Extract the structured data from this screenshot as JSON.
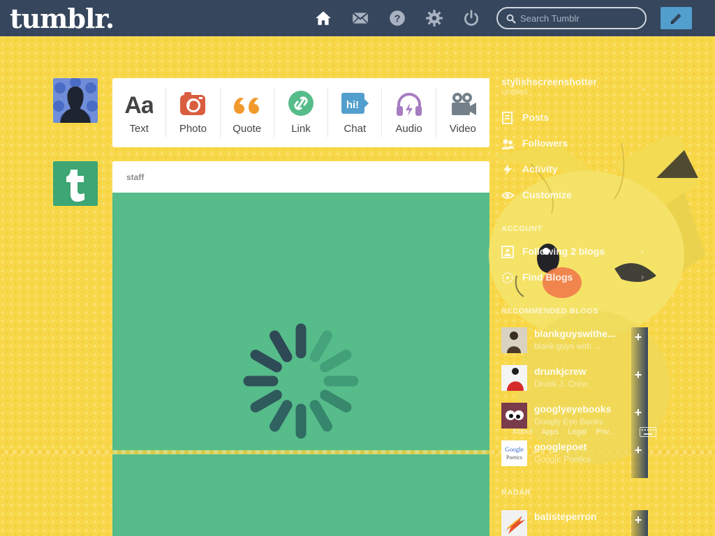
{
  "header": {
    "logo": "tumblr.",
    "search_placeholder": "Search Tumblr",
    "nav_icons": [
      "home-icon",
      "mail-icon",
      "help-icon",
      "gear-icon",
      "power-icon"
    ],
    "compose_icon": "pencil-icon",
    "colors": {
      "background": "#36465d",
      "compose": "#529ecc"
    }
  },
  "post_types": [
    {
      "label": "Text",
      "icon": "text-icon",
      "color": "#444444"
    },
    {
      "label": "Photo",
      "icon": "camera-icon",
      "color": "#d95e40"
    },
    {
      "label": "Quote",
      "icon": "quote-icon",
      "color": "#f2992e"
    },
    {
      "label": "Link",
      "icon": "link-icon",
      "color": "#56bc8a"
    },
    {
      "label": "Chat",
      "icon": "chat-icon",
      "color": "#529ecc"
    },
    {
      "label": "Audio",
      "icon": "headphones-icon",
      "color": "#a77dc2"
    },
    {
      "label": "Video",
      "icon": "video-camera-icon",
      "color": "#748089"
    }
  ],
  "post": {
    "author": "staff",
    "body_color": "#56bc8a"
  },
  "sidebar": {
    "blog_name": "stylishscreenshotter",
    "blog_subtitle": "Untitled",
    "items": [
      {
        "label": "Posts",
        "count": "",
        "icon": "posts-icon"
      },
      {
        "label": "Followers",
        "count": "",
        "icon": "followers-icon"
      },
      {
        "label": "Activity",
        "count": "",
        "icon": "activity-icon"
      },
      {
        "label": "Customize",
        "count": "",
        "icon": "eye-icon"
      }
    ],
    "account_section": "ACCOUNT",
    "account_items": [
      {
        "label": "Following 2 blogs",
        "icon": "following-icon"
      },
      {
        "label": "Find Blogs",
        "icon": "find-blogs-icon"
      }
    ],
    "recommended_section": "RECOMMENDED BLOGS",
    "recommended": [
      {
        "name": "blankguyswithe...",
        "subtitle": "blank guys with ...",
        "avatar_color": "#6b5a3a"
      },
      {
        "name": "drunkjcrew",
        "subtitle": "Drunk J. Crew",
        "avatar_color": "#d62b2b"
      },
      {
        "name": "googlyeyebooks",
        "subtitle": "Googly Eye Books",
        "avatar_color": "#7a3b4a"
      },
      {
        "name": "googlepoet",
        "subtitle": "Google Poetics",
        "avatar_color": "#ffffff"
      }
    ],
    "footer_links": [
      "About",
      "Apps",
      "Legal",
      "Priv..."
    ],
    "radar_section": "RADAR",
    "radar": {
      "name": "batisteperron",
      "subtitle": "",
      "avatar_color": "#f1f1f1"
    }
  }
}
